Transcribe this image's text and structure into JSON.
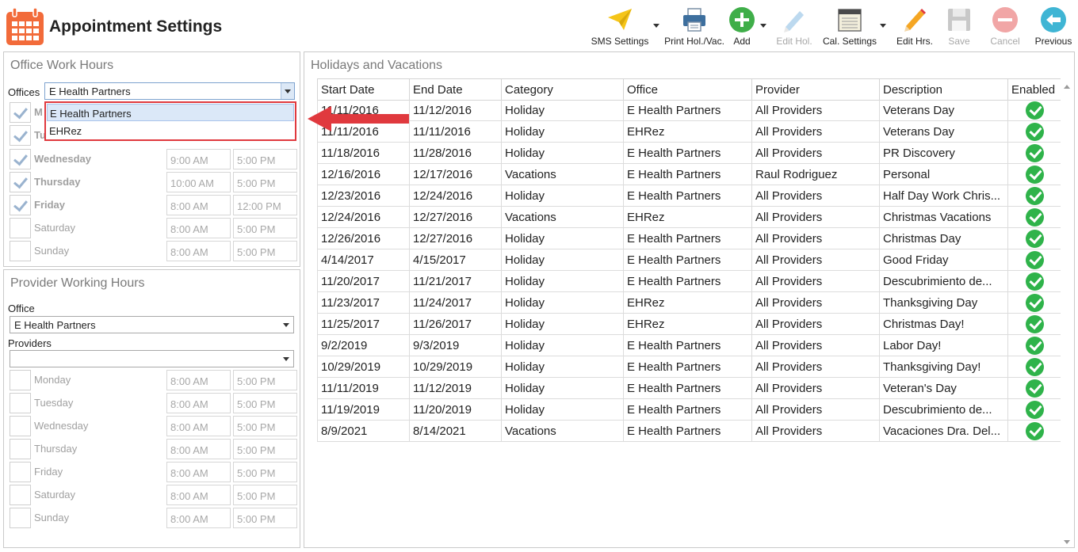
{
  "app": {
    "title": "Appointment Settings",
    "icon": "calendar-icon"
  },
  "toolbar": {
    "sms_settings": "SMS Settings",
    "print_hol_vac": "Print Hol./Vac.",
    "add": "Add",
    "edit_hol": "Edit Hol.",
    "cal_settings": "Cal. Settings",
    "edit_hrs": "Edit Hrs.",
    "save": "Save",
    "cancel": "Cancel",
    "previous": "Previous"
  },
  "office_work_hours": {
    "title": "Office Work Hours",
    "offices_label": "Offices",
    "offices_value": "E Health Partners",
    "dropdown_options": [
      "E Health Partners",
      "EHRez"
    ],
    "days": [
      {
        "name": "M",
        "checked": true,
        "start": "",
        "end": "",
        "bold": true
      },
      {
        "name": "Tu",
        "checked": true,
        "start": "",
        "end": "",
        "bold": true
      },
      {
        "name": "Wednesday",
        "checked": true,
        "start": "9:00 AM",
        "end": "5:00 PM",
        "bold": true
      },
      {
        "name": "Thursday",
        "checked": true,
        "start": "10:00 AM",
        "end": "5:00 PM",
        "bold": true
      },
      {
        "name": "Friday",
        "checked": true,
        "start": "8:00 AM",
        "end": "12:00 PM",
        "bold": true
      },
      {
        "name": "Saturday",
        "checked": false,
        "start": "8:00 AM",
        "end": "5:00 PM",
        "bold": false
      },
      {
        "name": "Sunday",
        "checked": false,
        "start": "8:00 AM",
        "end": "5:00 PM",
        "bold": false
      }
    ]
  },
  "provider_working_hours": {
    "title": "Provider Working Hours",
    "office_label": "Office",
    "office_value": "E Health Partners",
    "providers_label": "Providers",
    "providers_value": "",
    "days": [
      {
        "name": "Monday",
        "start": "8:00 AM",
        "end": "5:00 PM"
      },
      {
        "name": "Tuesday",
        "start": "8:00 AM",
        "end": "5:00 PM"
      },
      {
        "name": "Wednesday",
        "start": "8:00 AM",
        "end": "5:00 PM"
      },
      {
        "name": "Thursday",
        "start": "8:00 AM",
        "end": "5:00 PM"
      },
      {
        "name": "Friday",
        "start": "8:00 AM",
        "end": "5:00 PM"
      },
      {
        "name": "Saturday",
        "start": "8:00 AM",
        "end": "5:00 PM"
      },
      {
        "name": "Sunday",
        "start": "8:00 AM",
        "end": "5:00 PM"
      }
    ]
  },
  "holidays": {
    "title": "Holidays and Vacations",
    "columns": [
      "Start Date",
      "End Date",
      "Category",
      "Office",
      "Provider",
      "Description",
      "Enabled"
    ],
    "rows": [
      [
        "11/11/2016",
        "11/12/2016",
        "Holiday",
        "E Health Partners",
        "All Providers",
        "Veterans Day",
        true
      ],
      [
        "11/11/2016",
        "11/11/2016",
        "Holiday",
        "EHRez",
        "All Providers",
        "Veterans Day",
        true
      ],
      [
        "11/18/2016",
        "11/28/2016",
        "Holiday",
        "E Health Partners",
        "All Providers",
        "PR Discovery",
        true
      ],
      [
        "12/16/2016",
        "12/17/2016",
        "Vacations",
        "E Health Partners",
        "Raul Rodriguez",
        "Personal",
        true
      ],
      [
        "12/23/2016",
        "12/24/2016",
        "Holiday",
        "E Health Partners",
        "All Providers",
        "Half Day Work Chris...",
        true
      ],
      [
        "12/24/2016",
        "12/27/2016",
        "Vacations",
        "EHRez",
        "All Providers",
        "Christmas Vacations",
        true
      ],
      [
        "12/26/2016",
        "12/27/2016",
        "Holiday",
        "E Health Partners",
        "All Providers",
        "Christmas Day",
        true
      ],
      [
        "4/14/2017",
        "4/15/2017",
        "Holiday",
        "E Health Partners",
        "All Providers",
        "Good Friday",
        true
      ],
      [
        "11/20/2017",
        "11/21/2017",
        "Holiday",
        "E Health Partners",
        "All Providers",
        "Descubrimiento de...",
        true
      ],
      [
        "11/23/2017",
        "11/24/2017",
        "Holiday",
        "EHRez",
        "All Providers",
        "Thanksgiving Day",
        true
      ],
      [
        "11/25/2017",
        "11/26/2017",
        "Holiday",
        "EHRez",
        "All Providers",
        "Christmas Day!",
        true
      ],
      [
        "9/2/2019",
        "9/3/2019",
        "Holiday",
        "E Health Partners",
        "All Providers",
        "Labor Day!",
        true
      ],
      [
        "10/29/2019",
        "10/29/2019",
        "Holiday",
        "E Health Partners",
        "All Providers",
        "Thanksgiving Day!",
        true
      ],
      [
        "11/11/2019",
        "11/12/2019",
        "Holiday",
        "E Health Partners",
        "All Providers",
        "Veteran's Day",
        true
      ],
      [
        "11/19/2019",
        "11/20/2019",
        "Holiday",
        "E Health Partners",
        "All Providers",
        "Descubrimiento de...",
        true
      ],
      [
        "8/9/2021",
        "8/14/2021",
        "Vacations",
        "E Health Partners",
        "All Providers",
        "Vacaciones Dra. Del...",
        true
      ]
    ]
  },
  "colors": {
    "accent_orange": "#f26b3a",
    "enabled_green": "#2fb34a",
    "highlight_red": "#e0393e",
    "add_green": "#3fae49",
    "previous_teal": "#3fb5d4"
  }
}
